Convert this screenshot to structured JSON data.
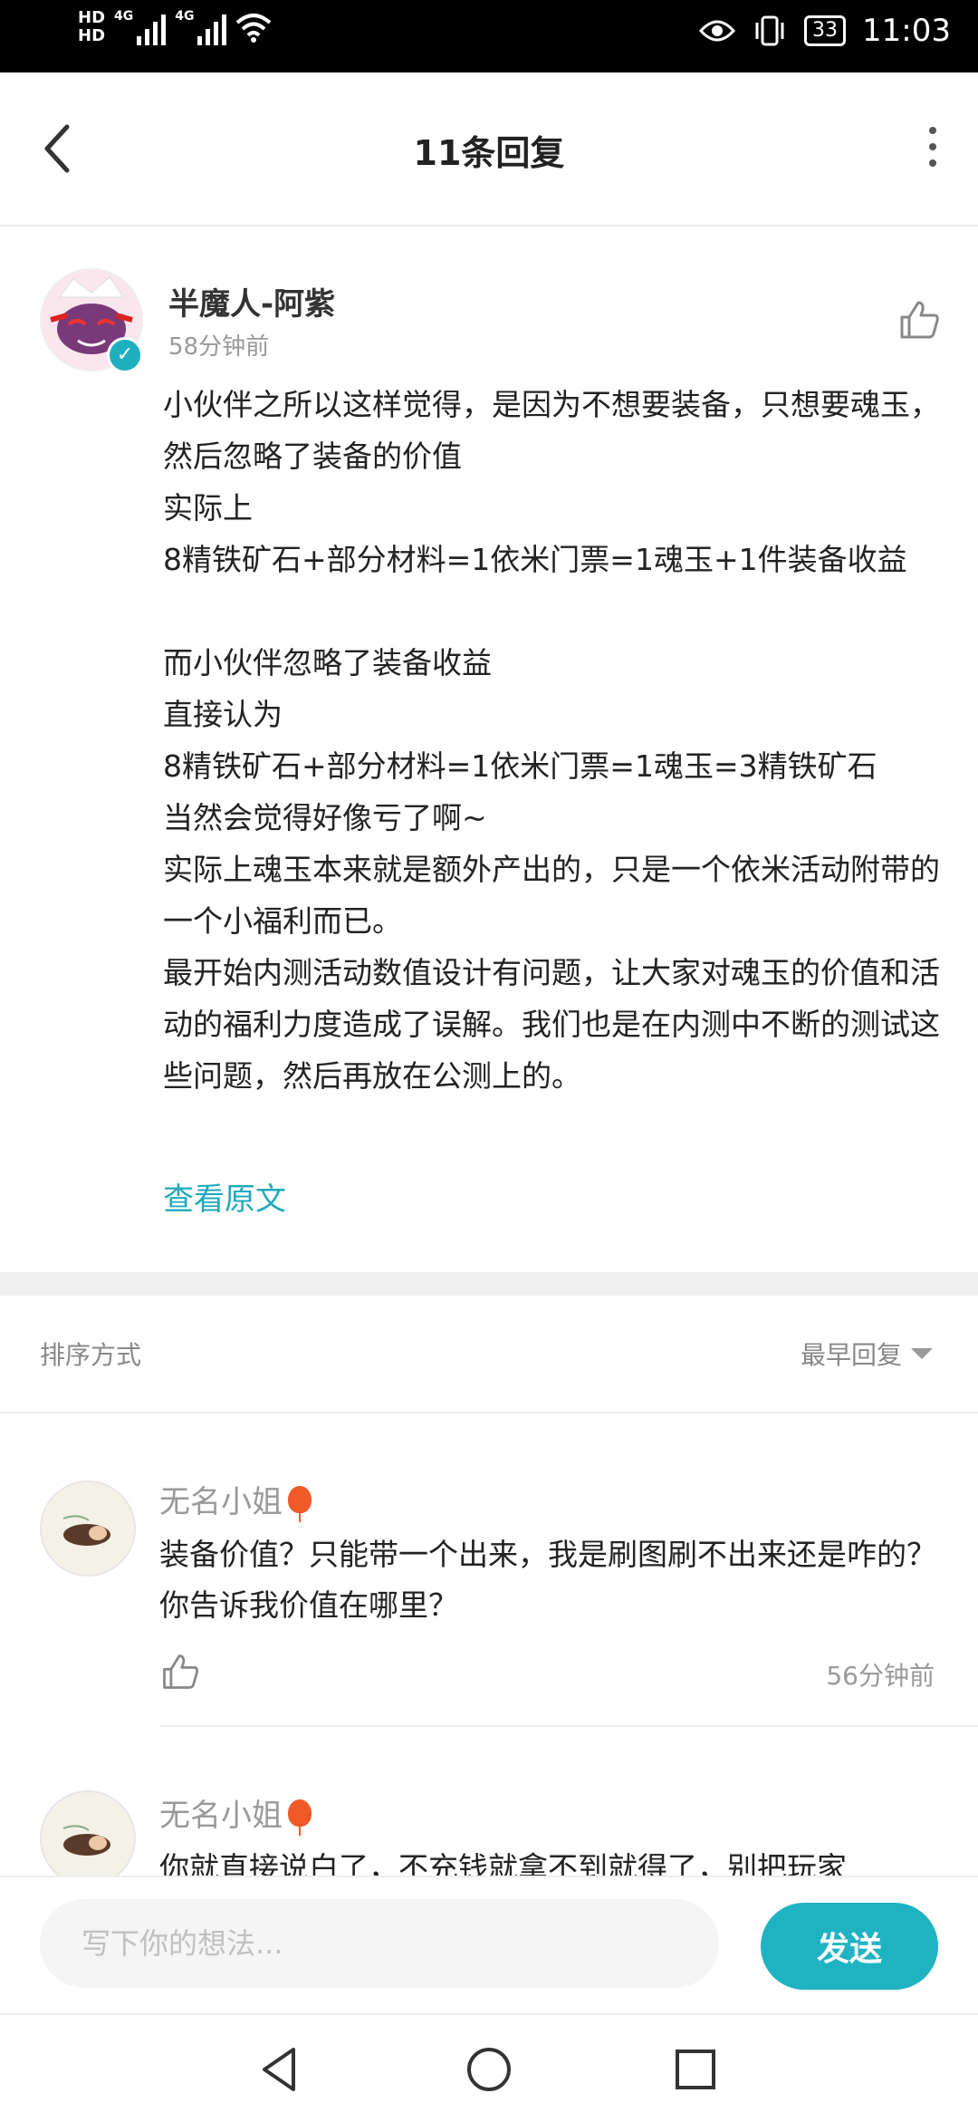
{
  "status_bar": {
    "hd1": "HD",
    "hd2": "HD",
    "net1": "4G",
    "net2": "4G",
    "battery": "33",
    "time": "11:03"
  },
  "header": {
    "title": "11条回复"
  },
  "post": {
    "author": "半魔人-阿紫",
    "time": "58分钟前",
    "body": "小伙伴之所以这样觉得，是因为不想要装备，只想要魂玉，然后忽略了装备的价值\n实际上\n8精铁矿石+部分材料=1依米门票=1魂玉+1件装备收益\n\n而小伙伴忽略了装备收益\n直接认为\n8精铁矿石+部分材料=1依米门票=1魂玉=3精铁矿石\n当然会觉得好像亏了啊~\n实际上魂玉本来就是额外产出的，只是一个依米活动附带的一个小福利而已。\n最开始内测活动数值设计有问题，让大家对魂玉的价值和活动的福利力度造成了误解。我们也是在内测中不断的测试这些问题，然后再放在公测上的。",
    "view_original": "查看原文"
  },
  "sort": {
    "label": "排序方式",
    "value": "最早回复"
  },
  "replies": [
    {
      "author": "无名小姐",
      "text": "装备价值？只能带一个出来，我是刷图刷不出来还是咋的？你告诉我价值在哪里？",
      "time": "56分钟前"
    },
    {
      "author": "无名小姐",
      "text": "你就直接说白了，不充钱就拿不到就得了，别把玩家"
    }
  ],
  "composer": {
    "placeholder": "写下你的想法...",
    "send_label": "发送"
  }
}
